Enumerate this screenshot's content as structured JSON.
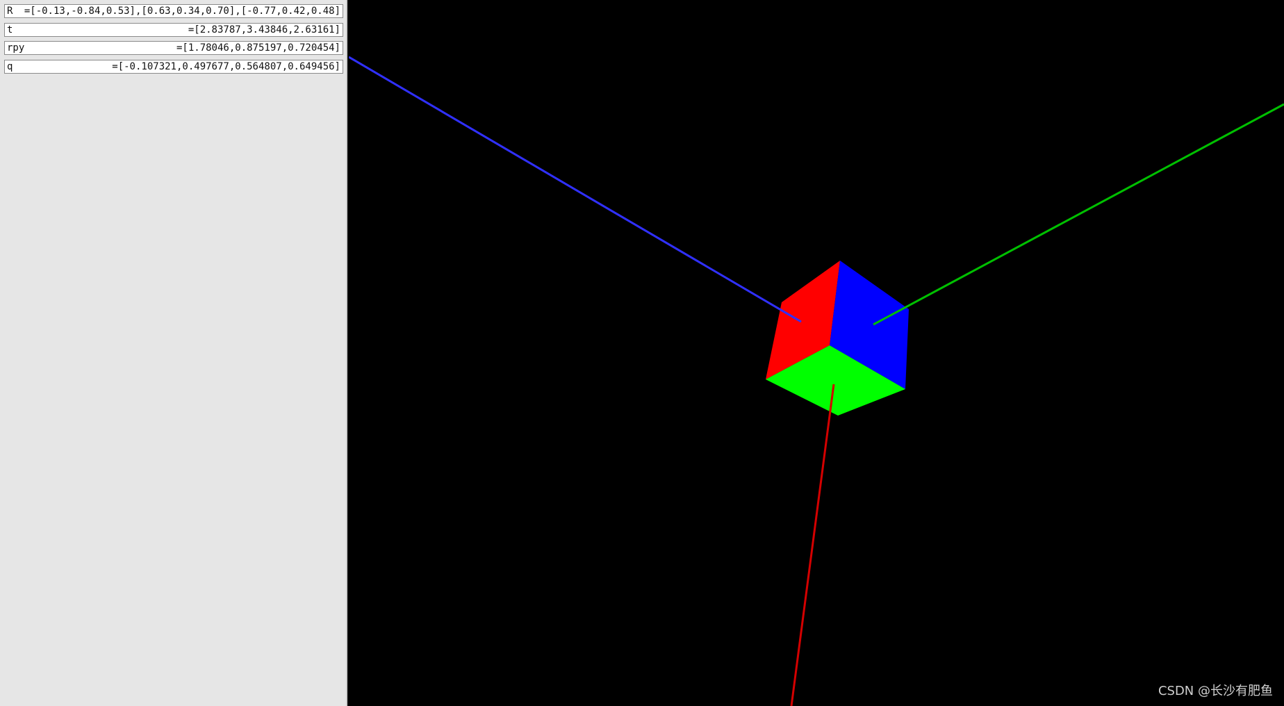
{
  "panel": {
    "rows": [
      {
        "label": "R",
        "value": "=[-0.13,-0.84,0.53],[0.63,0.34,0.70],[-0.77,0.42,0.48]"
      },
      {
        "label": "t",
        "value": "=[2.83787,3.43846,2.63161]"
      },
      {
        "label": "rpy",
        "value": "=[1.78046,0.875197,0.720454]"
      },
      {
        "label": "q",
        "value": "=[-0.107321,0.497677,0.564807,0.649456]"
      }
    ]
  },
  "scene": {
    "colors": {
      "background": "#000000",
      "axis_x": "#d40000",
      "axis_y": "#00c000",
      "axis_z": "#3030ff",
      "face_red": "#ff0000",
      "face_green": "#00ff00",
      "face_blue": "#0000ff"
    }
  },
  "watermark": {
    "text": "CSDN @长沙有肥鱼"
  }
}
